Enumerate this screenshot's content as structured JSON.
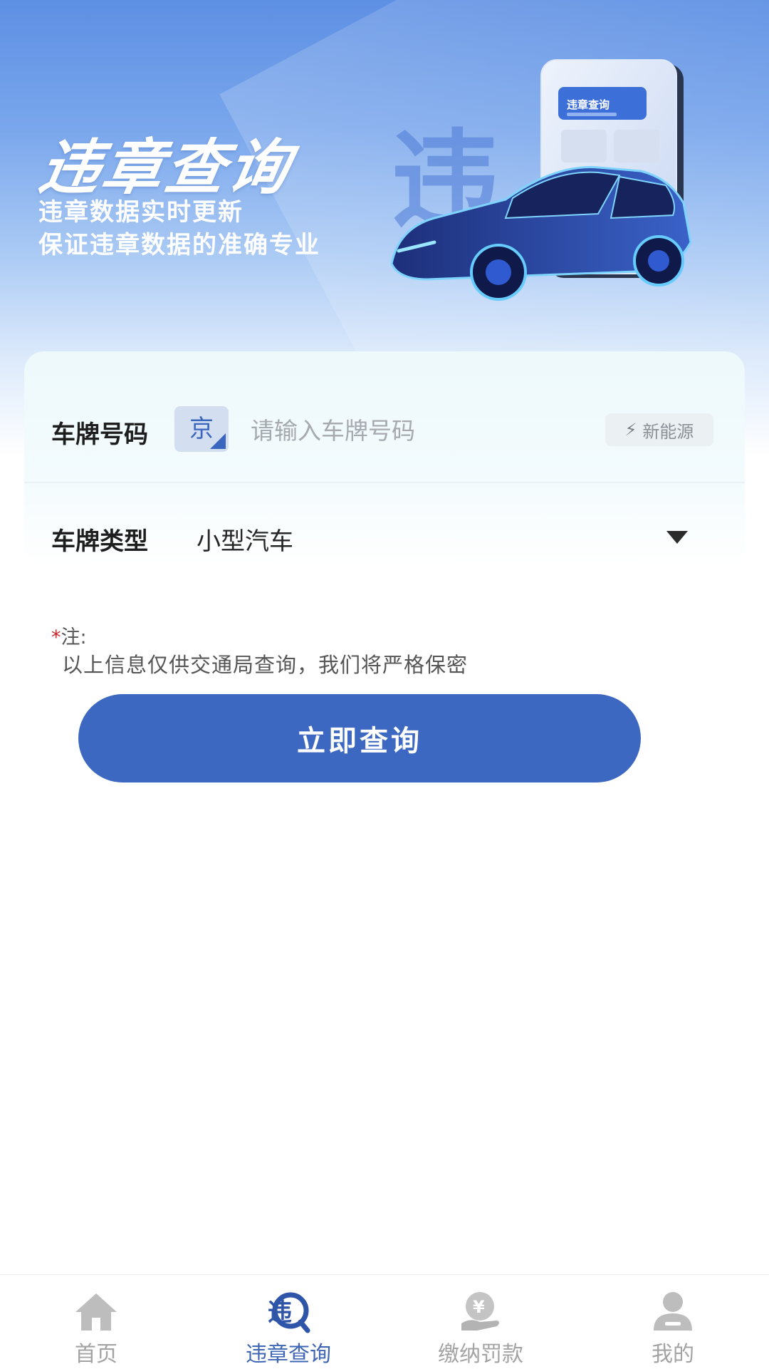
{
  "header": {
    "title": "违章查询",
    "subtitle_lines": [
      "违章数据实时更新",
      "保证违章数据的准确专业"
    ],
    "illustration_card_text": "违章查询"
  },
  "form": {
    "plate_number_label": "车牌号码",
    "province_prefix": "京",
    "plate_placeholder": "请输入车牌号码",
    "new_energy_label": "新能源",
    "plate_type_label": "车牌类型",
    "plate_type_value": "小型汽车"
  },
  "note": {
    "marker": "*",
    "heading": "注:",
    "text": "以上信息仅供交通局查询，我们将严格保密"
  },
  "query_button_label": "立即查询",
  "tabbar": {
    "items": [
      {
        "label": "首页",
        "icon": "home-icon",
        "active": false
      },
      {
        "label": "违章查询",
        "icon": "violation-query-icon",
        "active": true
      },
      {
        "label": "缴纳罚款",
        "icon": "pay-fine-icon",
        "active": false
      },
      {
        "label": "我的",
        "icon": "profile-icon",
        "active": false
      }
    ]
  },
  "colors": {
    "accent": "#3c68c2",
    "tab_active": "#3e66b4",
    "tab_inactive": "#a3a3a3",
    "required_star": "#d0232b"
  }
}
